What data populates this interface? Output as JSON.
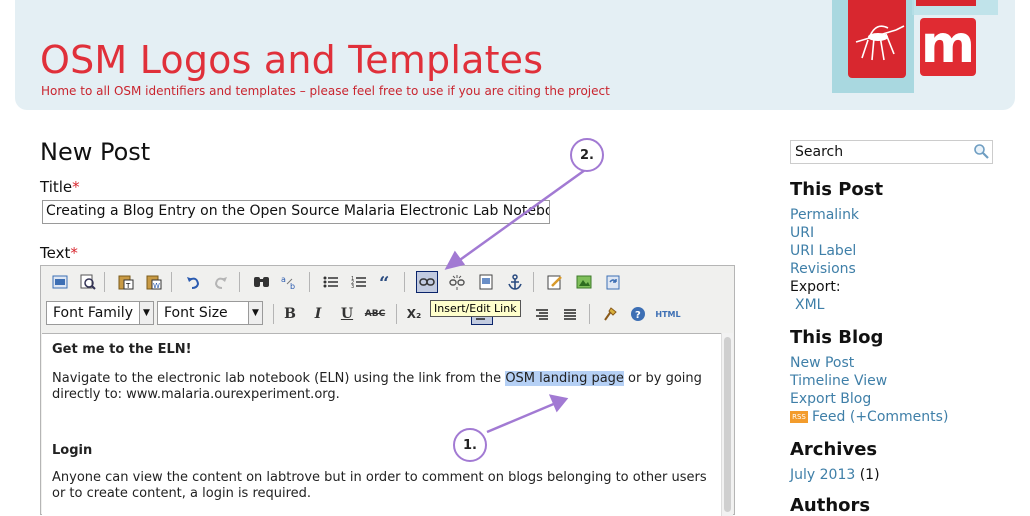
{
  "header": {
    "title": "OSM Logos and Templates",
    "tagline": "Home to all OSM identifiers and templates – please feel free to use if you are citing the project",
    "logo_letter": "m"
  },
  "post": {
    "page_title": "New Post",
    "title_label": "Title",
    "title_value": "Creating a Blog Entry on the Open Source Malaria Electronic Lab Notebook",
    "text_label": "Text",
    "required_mark": "*"
  },
  "editor": {
    "font_family": "Font Family",
    "font_size": "Font Size",
    "tooltip": "Insert/Edit Link",
    "bold": "B",
    "italic": "I",
    "underline": "U",
    "strike": "ABC",
    "subscript": "X₂",
    "html": "HTML",
    "content": {
      "heading1": "Get me to the ELN!",
      "para1_before": "Navigate to the electronic lab notebook (ELN) using the link from the ",
      "para1_link": "OSM landing page",
      "para1_after": " or by going directly to: www.malaria.ourexperiment.org.",
      "heading2": "Login",
      "para2": "Anyone can view the content on labtrove but in order to comment on blogs belonging to other users or to create content, a login is required."
    }
  },
  "annotations": {
    "marker1": "1.",
    "marker2": "2.",
    "color": "#a27ad3"
  },
  "sidebar": {
    "search_value": "Search",
    "this_post": {
      "heading": "This Post",
      "permalink": "Permalink",
      "uri": "URI",
      "uri_label": "URI Label",
      "revisions": "Revisions",
      "export": "Export:",
      "xml": "XML"
    },
    "this_blog": {
      "heading": "This Blog",
      "new_post": "New Post",
      "timeline": "Timeline View",
      "export_blog": "Export Blog",
      "feed": "Feed",
      "comments": "(+Comments)",
      "rss_badge": "RSS"
    },
    "archives": {
      "heading": "Archives",
      "month": "July 2013",
      "count": "(1)"
    },
    "authors": {
      "heading": "Authors"
    }
  },
  "colors": {
    "brand_red": "#e0303a",
    "link": "#3f7fa8",
    "header_bg": "#e4eff4"
  }
}
